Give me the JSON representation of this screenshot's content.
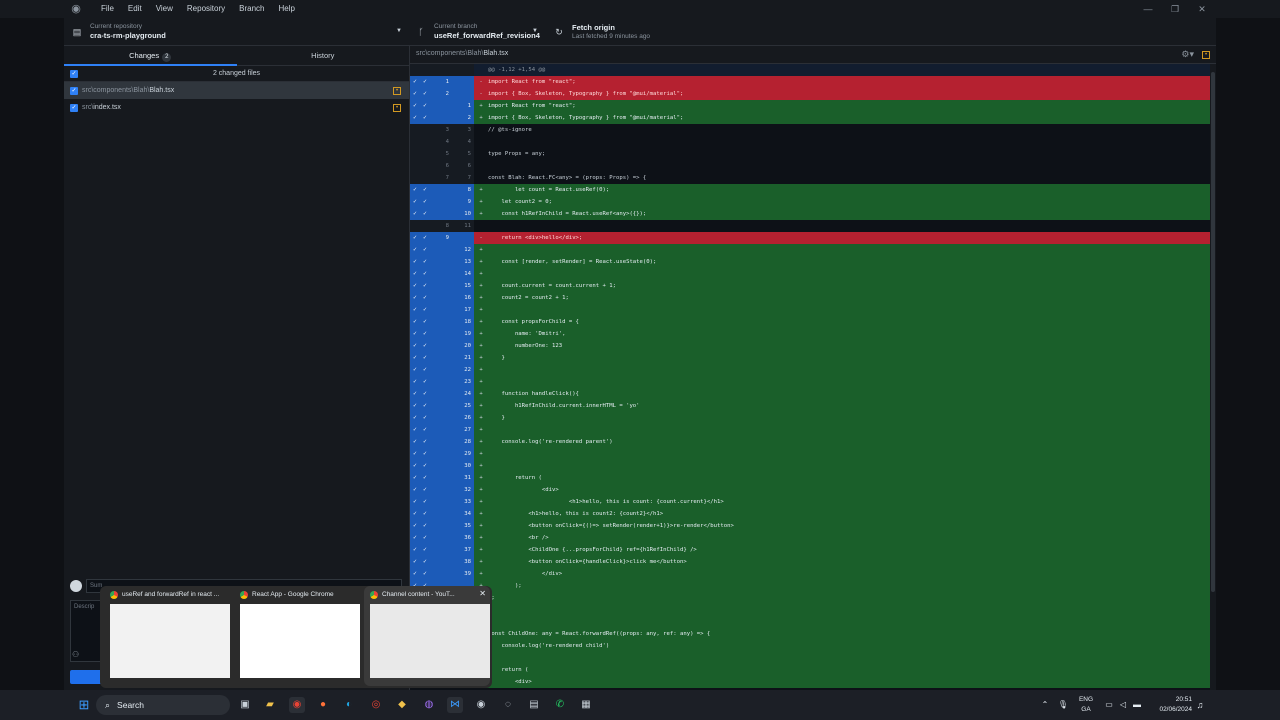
{
  "menubar": {
    "items": [
      "File",
      "Edit",
      "View",
      "Repository",
      "Branch",
      "Help"
    ],
    "window_controls": [
      "—",
      "❐",
      "✕"
    ]
  },
  "toolbar": {
    "repo_label": "Current repository",
    "repo_name": "cra-ts-rm-playground",
    "branch_label": "Current branch",
    "branch_name": "useRef_forwardRef_revision4",
    "fetch_label": "Fetch origin",
    "fetch_sub": "Last fetched 9 minutes ago"
  },
  "sidebar": {
    "tabs": [
      {
        "label": "Changes",
        "count": "2"
      },
      {
        "label": "History"
      }
    ],
    "changed_files_label": "2 changed files",
    "files": [
      {
        "dir": "src\\components\\Blah\\",
        "name": "Blah.tsx",
        "selected": true
      },
      {
        "dir": "src\\",
        "name": "index.tsx",
        "selected": false
      }
    ],
    "summary_placeholder": "Sum",
    "description_placeholder": "Descrip"
  },
  "diff": {
    "path_dir": "src\\components\\Blah\\",
    "path_file": "Blah.tsx",
    "lines": [
      {
        "t": "hunk",
        "o": "",
        "n": "",
        "s": "",
        "c": "@@ -1,12 +1,54 @@",
        "sel": false
      },
      {
        "t": "del",
        "o": "1",
        "n": "",
        "s": "-",
        "c": "import React from \"react\";",
        "sel": true
      },
      {
        "t": "del",
        "o": "2",
        "n": "",
        "s": "-",
        "c": "import { Box, Skeleton, Typography } from \"@mui/material\";",
        "sel": true
      },
      {
        "t": "add",
        "o": "",
        "n": "1",
        "s": "+",
        "c": "import React from \"react\";",
        "sel": true
      },
      {
        "t": "add",
        "o": "",
        "n": "2",
        "s": "+",
        "c": "import { Box, Skeleton, Typography } from \"@mui/material\";",
        "sel": true
      },
      {
        "t": "ctx",
        "o": "3",
        "n": "3",
        "s": "",
        "c": "// @ts-ignore",
        "sel": false
      },
      {
        "t": "ctx",
        "o": "4",
        "n": "4",
        "s": "",
        "c": "",
        "sel": false
      },
      {
        "t": "ctx",
        "o": "5",
        "n": "5",
        "s": "",
        "c": "type Props = any;",
        "sel": false
      },
      {
        "t": "ctx",
        "o": "6",
        "n": "6",
        "s": "",
        "c": "",
        "sel": false
      },
      {
        "t": "ctx",
        "o": "7",
        "n": "7",
        "s": "",
        "c": "const Blah: React.FC<any> = (props: Props) => {",
        "sel": false
      },
      {
        "t": "add",
        "o": "",
        "n": "8",
        "s": "+",
        "c": "        let count = React.useRef(0);",
        "sel": true
      },
      {
        "t": "add",
        "o": "",
        "n": "9",
        "s": "+",
        "c": "    let count2 = 0;",
        "sel": true
      },
      {
        "t": "add",
        "o": "",
        "n": "10",
        "s": "+",
        "c": "    const h1RefInChild = React.useRef<any>({});",
        "sel": true
      },
      {
        "t": "ctx",
        "o": "8",
        "n": "11",
        "s": "",
        "c": "",
        "sel": false
      },
      {
        "t": "del",
        "o": "9",
        "n": "",
        "s": "-",
        "c": "    return <div>hello</div>;",
        "sel": true
      },
      {
        "t": "add",
        "o": "",
        "n": "12",
        "s": "+",
        "c": "",
        "sel": true
      },
      {
        "t": "add",
        "o": "",
        "n": "13",
        "s": "+",
        "c": "    const [render, setRender] = React.useState(0);",
        "sel": true
      },
      {
        "t": "add",
        "o": "",
        "n": "14",
        "s": "+",
        "c": "",
        "sel": true
      },
      {
        "t": "add",
        "o": "",
        "n": "15",
        "s": "+",
        "c": "    count.current = count.current + 1;",
        "sel": true
      },
      {
        "t": "add",
        "o": "",
        "n": "16",
        "s": "+",
        "c": "    count2 = count2 + 1;",
        "sel": true
      },
      {
        "t": "add",
        "o": "",
        "n": "17",
        "s": "+",
        "c": "",
        "sel": true
      },
      {
        "t": "add",
        "o": "",
        "n": "18",
        "s": "+",
        "c": "    const propsForChild = {",
        "sel": true
      },
      {
        "t": "add",
        "o": "",
        "n": "19",
        "s": "+",
        "c": "        name: 'Dmitri',",
        "sel": true
      },
      {
        "t": "add",
        "o": "",
        "n": "20",
        "s": "+",
        "c": "        numberOne: 123",
        "sel": true
      },
      {
        "t": "add",
        "o": "",
        "n": "21",
        "s": "+",
        "c": "    }",
        "sel": true
      },
      {
        "t": "add",
        "o": "",
        "n": "22",
        "s": "+",
        "c": "",
        "sel": true
      },
      {
        "t": "add",
        "o": "",
        "n": "23",
        "s": "+",
        "c": "",
        "sel": true
      },
      {
        "t": "add",
        "o": "",
        "n": "24",
        "s": "+",
        "c": "    function handleClick(){",
        "sel": true
      },
      {
        "t": "add",
        "o": "",
        "n": "25",
        "s": "+",
        "c": "        h1RefInChild.current.innerHTML = 'yo'",
        "sel": true
      },
      {
        "t": "add",
        "o": "",
        "n": "26",
        "s": "+",
        "c": "    }",
        "sel": true
      },
      {
        "t": "add",
        "o": "",
        "n": "27",
        "s": "+",
        "c": "",
        "sel": true
      },
      {
        "t": "add",
        "o": "",
        "n": "28",
        "s": "+",
        "c": "    console.log('re-rendered parent')",
        "sel": true
      },
      {
        "t": "add",
        "o": "",
        "n": "29",
        "s": "+",
        "c": "",
        "sel": true
      },
      {
        "t": "add",
        "o": "",
        "n": "30",
        "s": "+",
        "c": "",
        "sel": true
      },
      {
        "t": "add",
        "o": "",
        "n": "31",
        "s": "+",
        "c": "        return (",
        "sel": true
      },
      {
        "t": "add",
        "o": "",
        "n": "32",
        "s": "+",
        "c": "                <div>",
        "sel": true
      },
      {
        "t": "add",
        "o": "",
        "n": "33",
        "s": "+",
        "c": "                        <h1>hello, this is count: {count.current}</h1>",
        "sel": true
      },
      {
        "t": "add",
        "o": "",
        "n": "34",
        "s": "+",
        "c": "            <h1>hello, this is count2: {count2}</h1>",
        "sel": true
      },
      {
        "t": "add",
        "o": "",
        "n": "35",
        "s": "+",
        "c": "            <button onClick={()=> setRender(render+1)}>re-render</button>",
        "sel": true
      },
      {
        "t": "add",
        "o": "",
        "n": "36",
        "s": "+",
        "c": "            <br />",
        "sel": true
      },
      {
        "t": "add",
        "o": "",
        "n": "37",
        "s": "+",
        "c": "            <ChildOne {...propsForChild} ref={h1RefInChild} />",
        "sel": true
      },
      {
        "t": "add",
        "o": "",
        "n": "38",
        "s": "+",
        "c": "            <button onClick={handleClick}>click me</button>",
        "sel": true
      },
      {
        "t": "add",
        "o": "",
        "n": "39",
        "s": "+",
        "c": "                </div>",
        "sel": true
      },
      {
        "t": "add",
        "o": "",
        "n": "",
        "s": "+",
        "c": "        );",
        "sel": true
      },
      {
        "t": "add",
        "o": "",
        "n": "",
        "s": "+",
        "c": "};",
        "sel": true
      },
      {
        "t": "add",
        "o": "",
        "n": "",
        "s": "+",
        "c": "",
        "sel": true
      },
      {
        "t": "add",
        "o": "",
        "n": "",
        "s": "+",
        "c": "",
        "sel": true
      },
      {
        "t": "add",
        "o": "",
        "n": "",
        "s": "+",
        "c": "const ChildOne: any = React.forwardRef((props: any, ref: any) => {",
        "sel": true
      },
      {
        "t": "add",
        "o": "",
        "n": "",
        "s": "+",
        "c": "    console.log('re-rendered child')",
        "sel": true
      },
      {
        "t": "add",
        "o": "",
        "n": "",
        "s": "+",
        "c": "",
        "sel": true
      },
      {
        "t": "add",
        "o": "",
        "n": "",
        "s": "+",
        "c": "    return (",
        "sel": true
      },
      {
        "t": "add",
        "o": "",
        "n": "",
        "s": "+",
        "c": "        <div>",
        "sel": true
      }
    ]
  },
  "thumbnails": [
    {
      "title": "useRef and forwardRef in react ..."
    },
    {
      "title": "React App - Google Chrome"
    },
    {
      "title": "Channel content - YouT..."
    }
  ],
  "taskbar": {
    "search_label": "Search",
    "lang_top": "ENG",
    "lang_bottom": "GA",
    "time": "20:51",
    "date": "02/06/2024"
  }
}
